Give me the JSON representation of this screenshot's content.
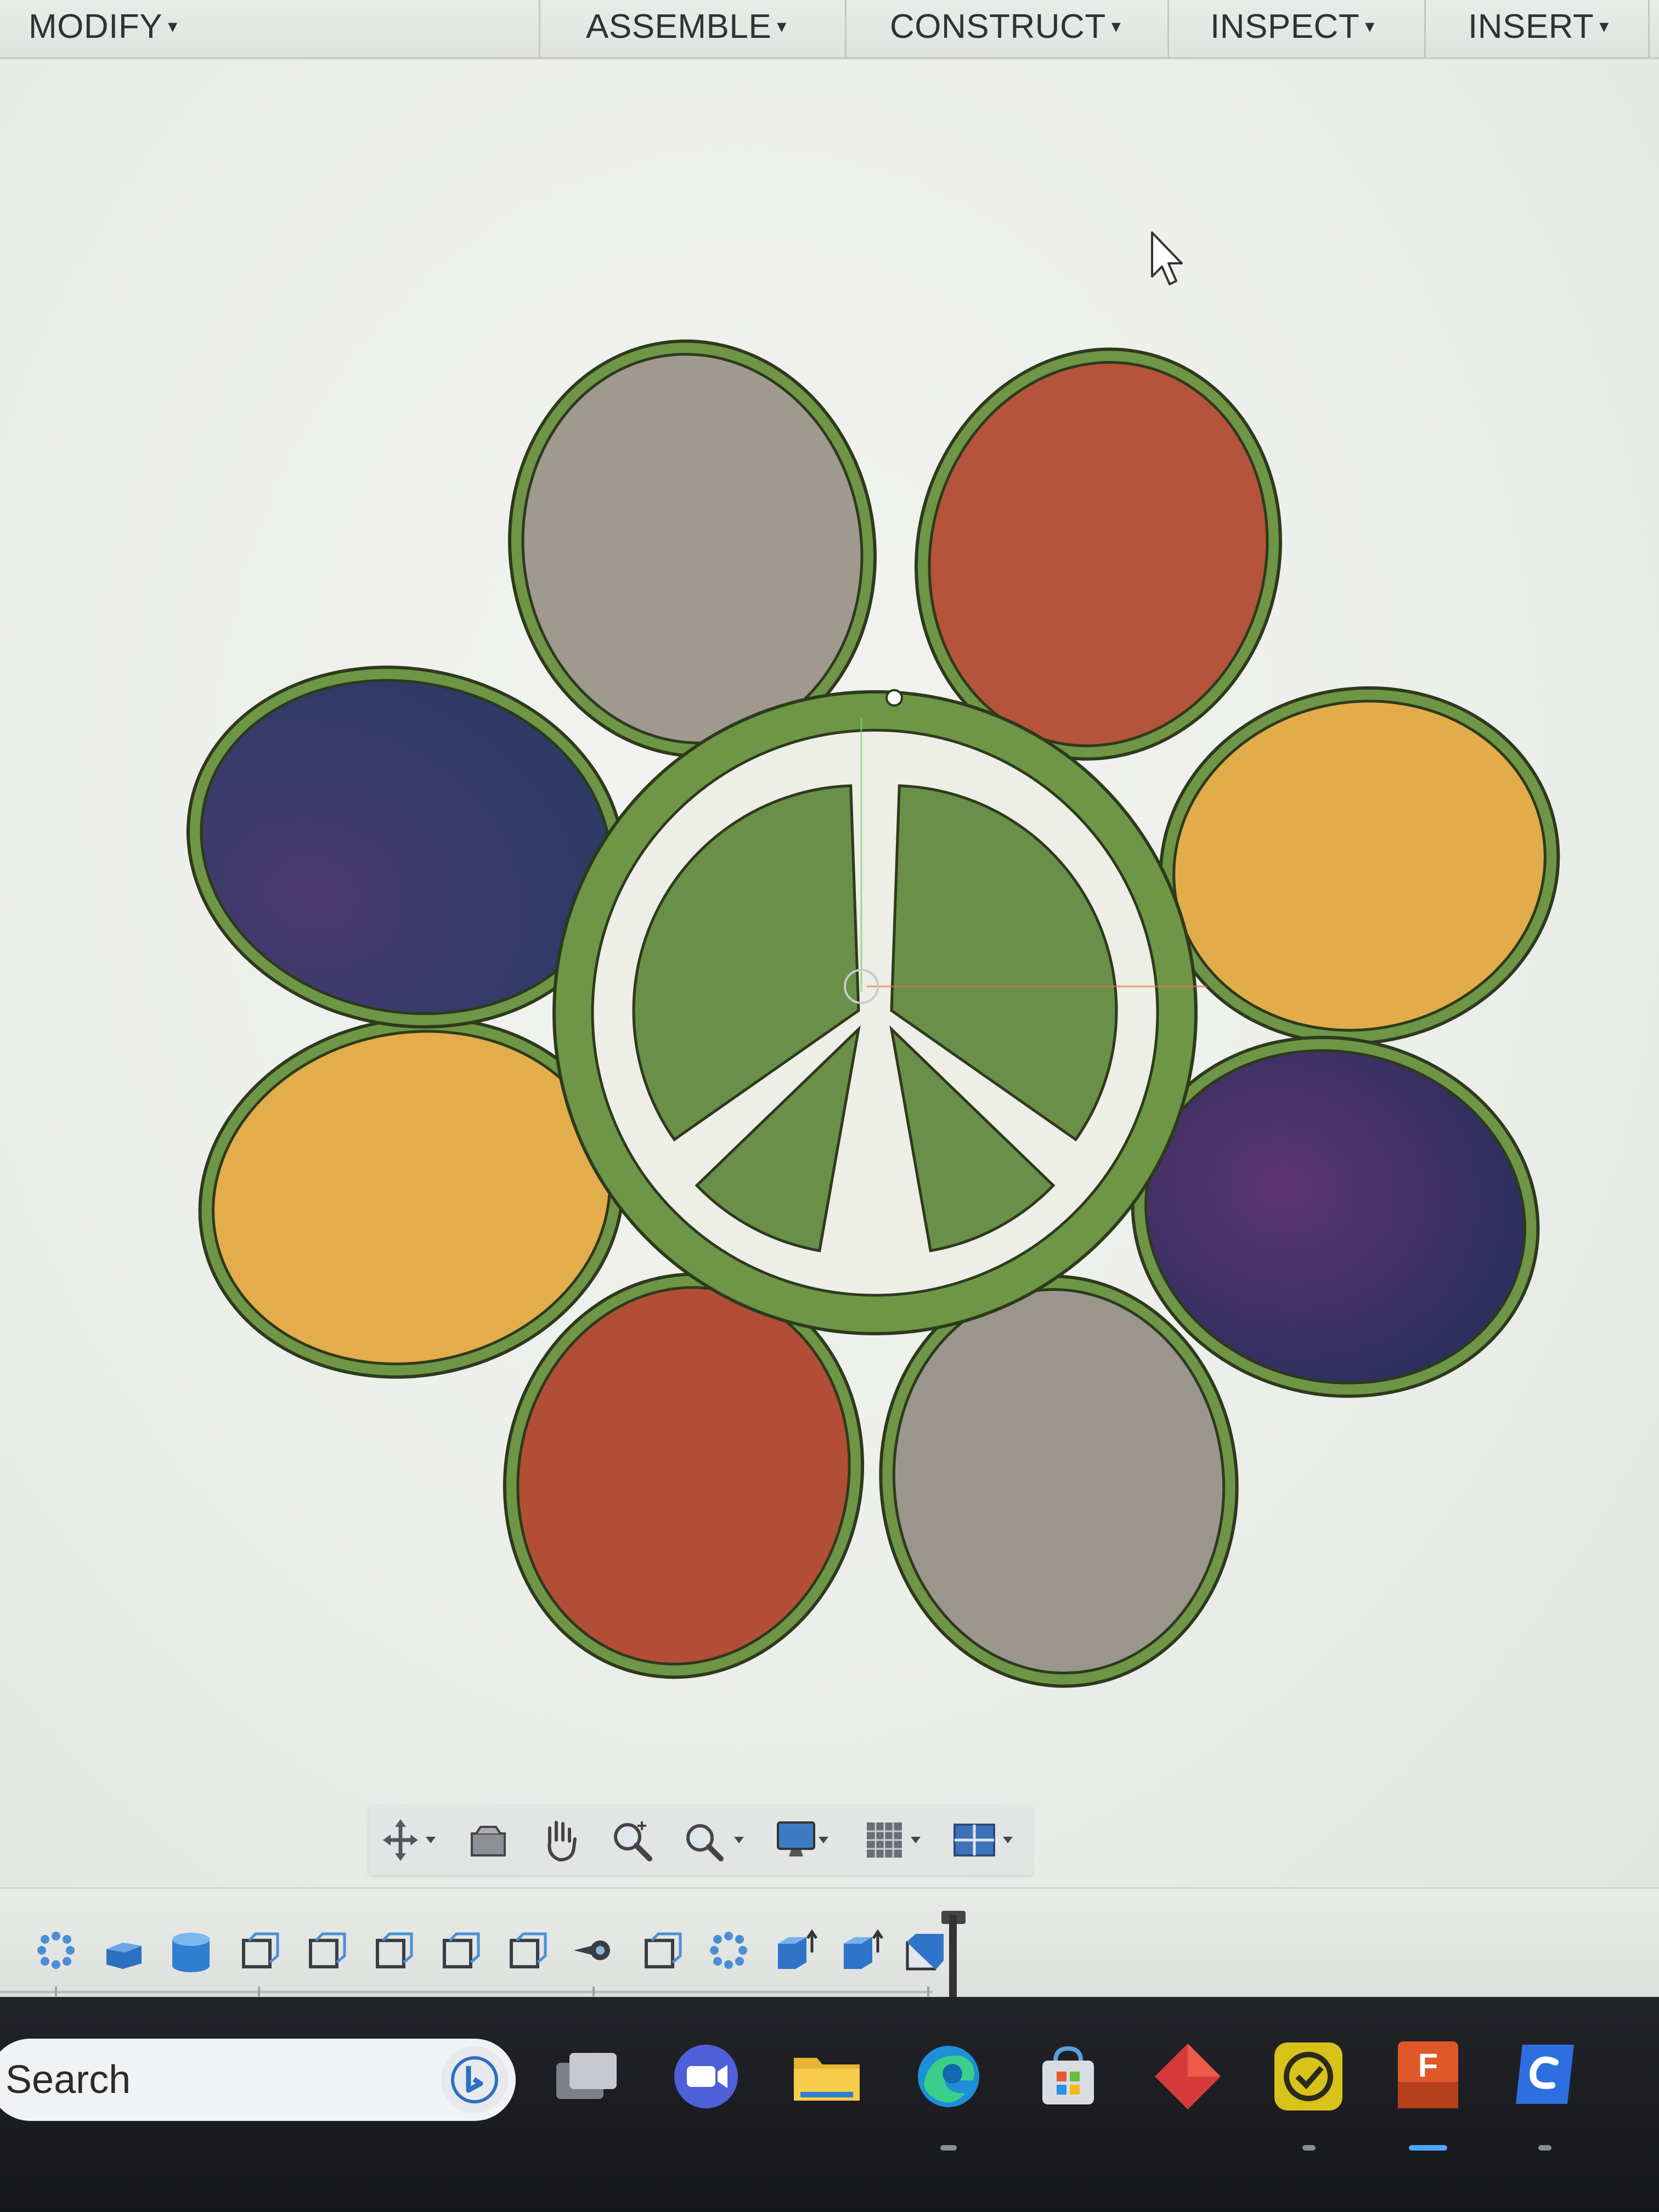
{
  "menubar": {
    "items": [
      {
        "label": "MODIFY",
        "caret": "▾"
      },
      {
        "label": "ASSEMBLE",
        "caret": "▾"
      },
      {
        "label": "CONSTRUCT",
        "caret": "▾"
      },
      {
        "label": "INSPECT",
        "caret": "▾"
      },
      {
        "label": "INSERT",
        "caret": "▾"
      }
    ]
  },
  "canvas": {
    "background": "#eef0ed",
    "design": {
      "name": "peace-flower",
      "outline_color": "#6e9646",
      "center_fill": "#eceee7",
      "peace_segment_color": "#6a8f48",
      "petal_colors": {
        "top_left": "#9f9990",
        "top_right": "#b5543b",
        "upper_right": "#e3ac4a",
        "lower_right": "#41356d",
        "bottom_right": "#9b968d",
        "bottom_left": "#b34e36",
        "lower_left": "#e3ad4b",
        "upper_left": "#3a3c72"
      }
    },
    "cursor_icon": "arrow-cursor-icon"
  },
  "navbar": {
    "buttons": [
      "orbit-icon",
      "look-at-icon",
      "pan-icon",
      "zoom-icon",
      "fit-icon",
      "display-settings-icon",
      "grid-settings-icon",
      "viewports-icon"
    ]
  },
  "timeline": {
    "items": [
      "pattern-icon",
      "combine-icon",
      "cylinder-icon",
      "offset-plane-icon",
      "offset-plane-icon",
      "offset-plane-icon",
      "offset-plane-icon",
      "offset-plane-icon",
      "joint-icon",
      "offset-plane-icon",
      "pattern-icon",
      "extrude-icon",
      "extrude-icon",
      "extrude-icon"
    ]
  },
  "taskbar": {
    "search_label": "Search",
    "bing_icon": "bing-icon",
    "apps": [
      "task-view-icon",
      "meet-camera-icon",
      "file-explorer-icon",
      "edge-icon",
      "store-icon",
      "red-diamond-app-icon",
      "task-check-app-icon",
      "fusion-360-icon",
      "c-app-icon"
    ],
    "fusion_badge": "F"
  }
}
